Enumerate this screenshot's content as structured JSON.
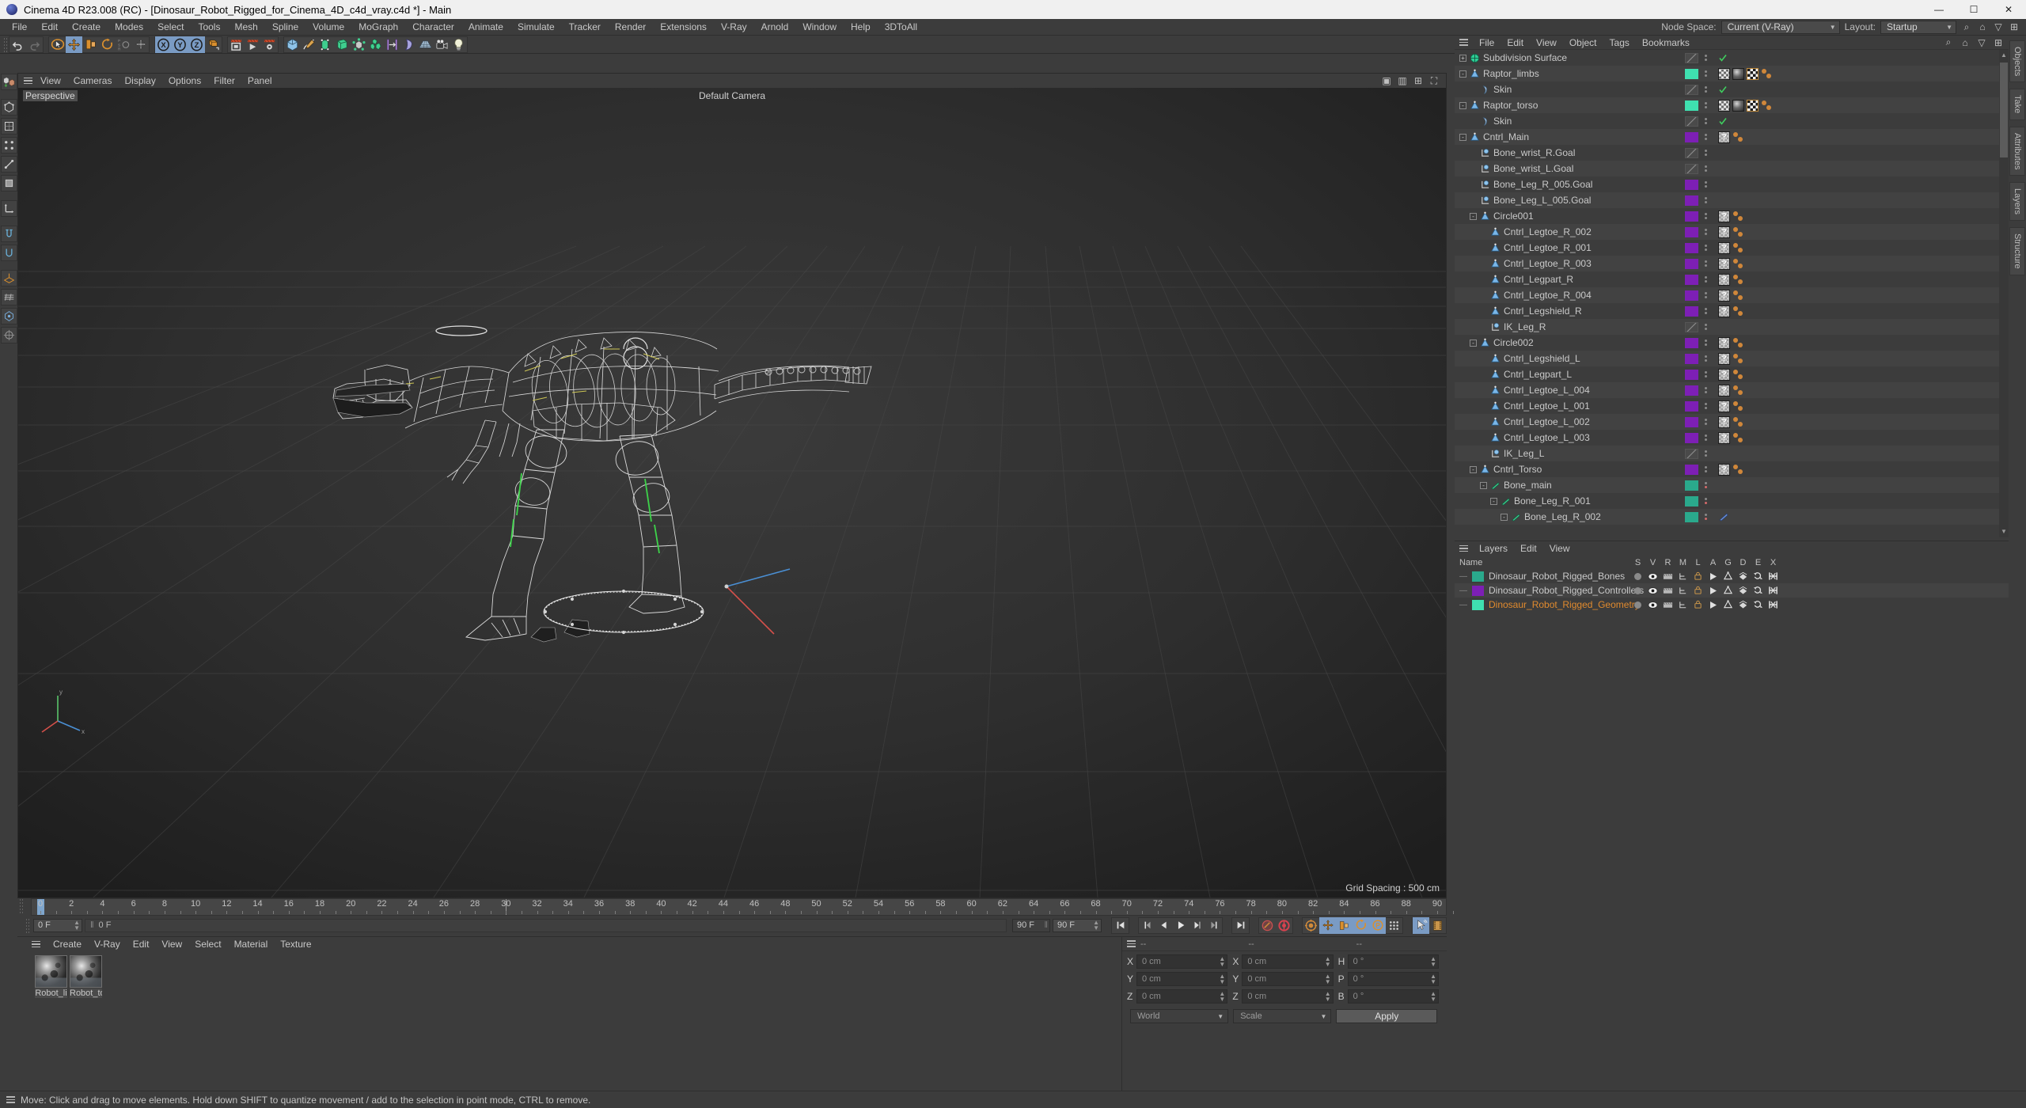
{
  "window": {
    "title": "Cinema 4D R23.008 (RC) - [Dinosaur_Robot_Rigged_for_Cinema_4D_c4d_vray.c4d *] - Main",
    "minimize": "—",
    "maximize": "☐",
    "close": "✕"
  },
  "menubar": {
    "items": [
      "File",
      "Edit",
      "Create",
      "Modes",
      "Select",
      "Tools",
      "Mesh",
      "Spline",
      "Volume",
      "MoGraph",
      "Character",
      "Animate",
      "Simulate",
      "Tracker",
      "Render",
      "Extensions",
      "V-Ray",
      "Arnold",
      "Window",
      "Help",
      "3DToAll"
    ],
    "node_space_label": "Node Space:",
    "node_space_value": "Current (V-Ray)",
    "layout_label": "Layout:",
    "layout_value": "Startup"
  },
  "viewport": {
    "menu": [
      "View",
      "Cameras",
      "Display",
      "Options",
      "Filter",
      "Panel"
    ],
    "label": "Perspective",
    "camera": "Default Camera",
    "grid_spacing": "Grid Spacing : 500 cm"
  },
  "timeline": {
    "ticks": [
      "0",
      "2",
      "4",
      "6",
      "8",
      "10",
      "12",
      "14",
      "16",
      "18",
      "20",
      "22",
      "24",
      "26",
      "28",
      "30",
      "32",
      "34",
      "36",
      "38",
      "40",
      "42",
      "44",
      "46",
      "48",
      "50",
      "52",
      "54",
      "56",
      "58",
      "60",
      "62",
      "64",
      "66",
      "68",
      "70",
      "72",
      "74",
      "76",
      "78",
      "80",
      "82",
      "84",
      "86",
      "88",
      "90"
    ],
    "current_frame": "0 F",
    "current_frame_field": "0 F",
    "end_frame": "90 F",
    "end_frame_field": "90 F",
    "preview_min": "0 F"
  },
  "materials": {
    "menu": [
      "Create",
      "V-Ray",
      "Edit",
      "View",
      "Select",
      "Material",
      "Texture"
    ],
    "items": [
      {
        "name": "Robot_li"
      },
      {
        "name": "Robot_to"
      }
    ]
  },
  "coordinates": {
    "headers": [
      "--",
      "--",
      "--"
    ],
    "position": {
      "label_x": "X",
      "label_y": "Y",
      "label_z": "Z",
      "x": "0 cm",
      "y": "0 cm",
      "z": "0 cm"
    },
    "size": {
      "label_x": "X",
      "label_y": "Y",
      "label_z": "Z",
      "x": "0 cm",
      "y": "0 cm",
      "z": "0 cm"
    },
    "rotation": {
      "label_h": "H",
      "label_p": "P",
      "label_b": "B",
      "h": "0 °",
      "p": "0 °",
      "b": "0 °"
    },
    "space": "World",
    "mode": "Scale",
    "apply": "Apply"
  },
  "object_manager": {
    "menu": [
      "File",
      "Edit",
      "View",
      "Object",
      "Tags",
      "Bookmarks"
    ],
    "rows": [
      {
        "name": "Subdivision Surface",
        "indent": 0,
        "icon": "subdivision",
        "expander": "+",
        "chip": "none",
        "tags": [
          "visible-check"
        ]
      },
      {
        "name": "Raptor_limbs",
        "indent": 0,
        "icon": "null",
        "expander": "-",
        "chip": "#3fe0b0",
        "tags": [
          "texture-check",
          "material",
          "checker",
          "dot-dot"
        ]
      },
      {
        "name": "Skin",
        "indent": 1,
        "icon": "skin",
        "expander": "",
        "chip": "none",
        "tags": [
          "visible-check"
        ]
      },
      {
        "name": "Raptor_torso",
        "indent": 0,
        "icon": "null",
        "expander": "-",
        "chip": "#3fe0b0",
        "tags": [
          "texture-check",
          "material",
          "checker",
          "dot-dot"
        ]
      },
      {
        "name": "Skin",
        "indent": 1,
        "icon": "skin",
        "expander": "",
        "chip": "none",
        "tags": [
          "visible-check"
        ]
      },
      {
        "name": "Cntrl_Main",
        "indent": 0,
        "icon": "null",
        "expander": "-",
        "chip": "#7d1fb5",
        "tags": [
          "question",
          "dot-dot"
        ]
      },
      {
        "name": "Bone_wrist_R.Goal",
        "indent": 1,
        "icon": "goal",
        "expander": "",
        "chip": "none",
        "tags": []
      },
      {
        "name": "Bone_wrist_L.Goal",
        "indent": 1,
        "icon": "goal",
        "expander": "",
        "chip": "none",
        "tags": []
      },
      {
        "name": "Bone_Leg_R_005.Goal",
        "indent": 1,
        "icon": "goal",
        "expander": "",
        "chip": "#7d1fb5",
        "tags": []
      },
      {
        "name": "Bone_Leg_L_005.Goal",
        "indent": 1,
        "icon": "goal",
        "expander": "",
        "chip": "#7d1fb5",
        "tags": []
      },
      {
        "name": "Circle001",
        "indent": 1,
        "icon": "null",
        "expander": "-",
        "chip": "#7d1fb5",
        "tags": [
          "question",
          "dot-dot"
        ]
      },
      {
        "name": "Cntrl_Legtoe_R_002",
        "indent": 2,
        "icon": "null",
        "expander": "",
        "chip": "#7d1fb5",
        "tags": [
          "question",
          "dot-dot"
        ]
      },
      {
        "name": "Cntrl_Legtoe_R_001",
        "indent": 2,
        "icon": "null",
        "expander": "",
        "chip": "#7d1fb5",
        "tags": [
          "question",
          "dot-dot"
        ]
      },
      {
        "name": "Cntrl_Legtoe_R_003",
        "indent": 2,
        "icon": "null",
        "expander": "",
        "chip": "#7d1fb5",
        "tags": [
          "question",
          "dot-dot"
        ]
      },
      {
        "name": "Cntrl_Legpart_R",
        "indent": 2,
        "icon": "null",
        "expander": "",
        "chip": "#7d1fb5",
        "tags": [
          "question",
          "dot-dot"
        ]
      },
      {
        "name": "Cntrl_Legtoe_R_004",
        "indent": 2,
        "icon": "null",
        "expander": "",
        "chip": "#7d1fb5",
        "tags": [
          "question",
          "dot-dot"
        ]
      },
      {
        "name": "Cntrl_Legshield_R",
        "indent": 2,
        "icon": "null",
        "expander": "",
        "chip": "#7d1fb5",
        "tags": [
          "question",
          "dot-dot"
        ]
      },
      {
        "name": "IK_Leg_R",
        "indent": 2,
        "icon": "goal",
        "expander": "",
        "chip": "none",
        "tags": []
      },
      {
        "name": "Circle002",
        "indent": 1,
        "icon": "null",
        "expander": "-",
        "chip": "#7d1fb5",
        "tags": [
          "question",
          "dot-dot"
        ]
      },
      {
        "name": "Cntrl_Legshield_L",
        "indent": 2,
        "icon": "null",
        "expander": "",
        "chip": "#7d1fb5",
        "tags": [
          "question",
          "dot-dot"
        ]
      },
      {
        "name": "Cntrl_Legpart_L",
        "indent": 2,
        "icon": "null",
        "expander": "",
        "chip": "#7d1fb5",
        "tags": [
          "question",
          "dot-dot"
        ]
      },
      {
        "name": "Cntrl_Legtoe_L_004",
        "indent": 2,
        "icon": "null",
        "expander": "",
        "chip": "#7d1fb5",
        "tags": [
          "question",
          "dot-dot"
        ]
      },
      {
        "name": "Cntrl_Legtoe_L_001",
        "indent": 2,
        "icon": "null",
        "expander": "",
        "chip": "#7d1fb5",
        "tags": [
          "question",
          "dot-dot"
        ]
      },
      {
        "name": "Cntrl_Legtoe_L_002",
        "indent": 2,
        "icon": "null",
        "expander": "",
        "chip": "#7d1fb5",
        "tags": [
          "question",
          "dot-dot"
        ]
      },
      {
        "name": "Cntrl_Legtoe_L_003",
        "indent": 2,
        "icon": "null",
        "expander": "",
        "chip": "#7d1fb5",
        "tags": [
          "question",
          "dot-dot"
        ]
      },
      {
        "name": "IK_Leg_L",
        "indent": 2,
        "icon": "goal",
        "expander": "",
        "chip": "none",
        "tags": []
      },
      {
        "name": "Cntrl_Torso",
        "indent": 1,
        "icon": "null",
        "expander": "-",
        "chip": "#7d1fb5",
        "tags": [
          "question",
          "dot-dot"
        ]
      },
      {
        "name": "Bone_main",
        "indent": 2,
        "icon": "bone",
        "expander": "-",
        "chip": "#2aa98c",
        "tags": []
      },
      {
        "name": "Bone_Leg_R_001",
        "indent": 3,
        "icon": "bone",
        "expander": "-",
        "chip": "#2aa98c",
        "tags": []
      },
      {
        "name": "Bone_Leg_R_002",
        "indent": 4,
        "icon": "bone",
        "expander": "-",
        "chip": "#2aa98c",
        "tags": [
          "bone-tag"
        ]
      }
    ]
  },
  "layers": {
    "menu": [
      "Layers",
      "Edit",
      "View"
    ],
    "columns": [
      "Name",
      "S",
      "V",
      "R",
      "M",
      "L",
      "A",
      "G",
      "D",
      "E",
      "X"
    ],
    "rows": [
      {
        "name": "Dinosaur_Robot_Rigged_Bones",
        "color": "#2aa98c",
        "selected": false
      },
      {
        "name": "Dinosaur_Robot_Rigged_Controllers",
        "color": "#7d1fb5",
        "selected": false
      },
      {
        "name": "Dinosaur_Robot_Rigged_Geometry",
        "color": "#3fe0b0",
        "selected": true
      }
    ]
  },
  "right_rail": {
    "tabs": [
      "Objects",
      "Take",
      "Attributes",
      "Layers",
      "Structure"
    ]
  },
  "statusbar": {
    "text": "Move: Click and drag to move elements. Hold down SHIFT to quantize movement / add to the selection in point mode, CTRL to remove."
  },
  "colors": {
    "accent_blue": "#7a9bc4",
    "orange": "#d18e3c",
    "green_chip": "#3fe0b0",
    "purple_chip": "#7d1fb5",
    "teal_chip": "#2aa98c",
    "selected_text": "#e08a2e"
  }
}
